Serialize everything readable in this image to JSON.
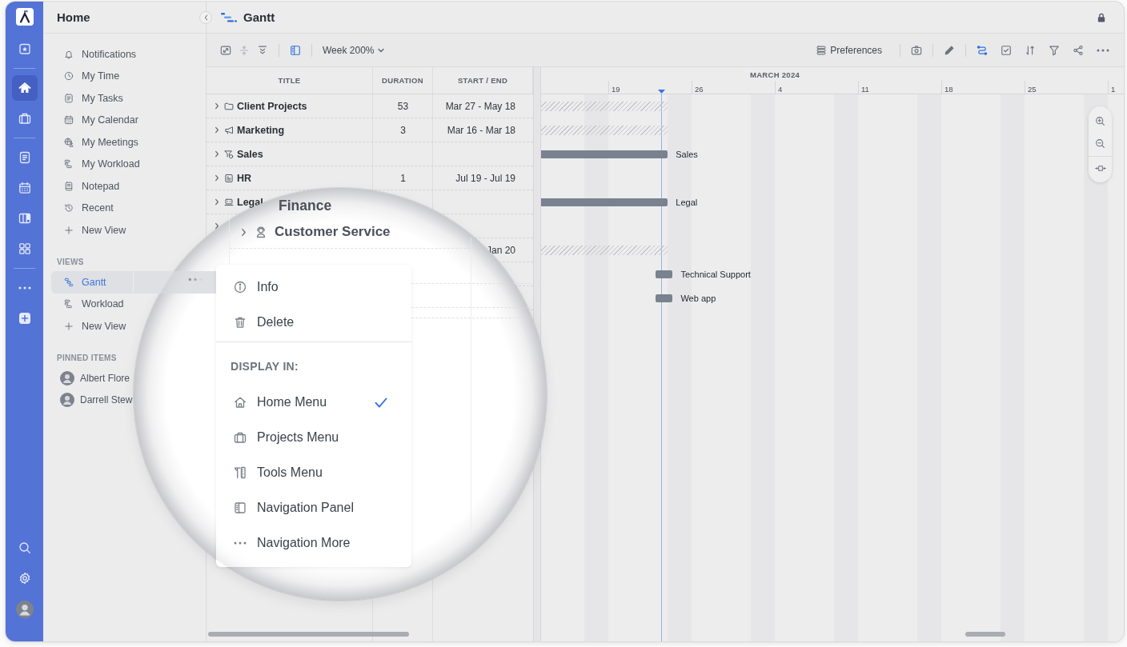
{
  "rail": {
    "groups": [
      [
        {
          "selected": false
        }
      ],
      [
        {
          "selected": true
        },
        {
          "selected": false
        }
      ],
      [
        {
          "selected": false
        },
        {
          "selected": false
        },
        {
          "selected": false
        },
        {
          "selected": false
        }
      ],
      [
        {
          "selected": false
        },
        {
          "selected": false
        }
      ]
    ],
    "bottom": [
      {
        "selected": false
      },
      {
        "selected": false
      }
    ]
  },
  "sidebar": {
    "title": "Home",
    "items": [
      {
        "label": "Notifications"
      },
      {
        "label": "My Time"
      },
      {
        "label": "My Tasks"
      },
      {
        "label": "My Calendar"
      },
      {
        "label": "My Meetings"
      },
      {
        "label": "My Workload"
      },
      {
        "label": "Notepad"
      },
      {
        "label": "Recent"
      },
      {
        "label": "New View"
      }
    ],
    "views_heading": "VIEWS",
    "views": [
      {
        "label": "Gantt",
        "selected": true
      },
      {
        "label": "Workload",
        "selected": false
      },
      {
        "label": "New View",
        "selected": false
      }
    ],
    "pinned_heading": "PINNED ITEMS",
    "pinned": [
      {
        "name": "Albert Flore"
      },
      {
        "name": "Darrell Stew"
      }
    ]
  },
  "header": {
    "title": "Gantt"
  },
  "toolbar": {
    "left_tools": [
      {
        "on": false,
        "disabled": false
      },
      {
        "on": false,
        "disabled": true
      },
      {
        "on": false,
        "disabled": false
      },
      {
        "on": true,
        "disabled": false
      }
    ],
    "scale": "Week 200%",
    "preferences": "Preferences",
    "right_tools": [
      {
        "on": false
      },
      {
        "on": false
      },
      {
        "on": true
      },
      {
        "on": false
      },
      {
        "on": false
      },
      {
        "on": false
      },
      {
        "on": false
      },
      {
        "on": false
      }
    ]
  },
  "table": {
    "columns": [
      "TITLE",
      "DURATION",
      "START / END"
    ],
    "rows": [
      {
        "title": "Client Projects",
        "expanded": false,
        "duration": "53",
        "dates": "Mar 27 - May 18",
        "bar": {
          "kind": "hatched"
        }
      },
      {
        "title": "Marketing",
        "expanded": false,
        "duration": "3",
        "dates": "Mar 16 - Mar 18",
        "bar": {
          "kind": "hatched"
        }
      },
      {
        "title": "Sales",
        "expanded": false,
        "bar": {
          "kind": "solid",
          "label": "Sales"
        }
      },
      {
        "title": "HR",
        "expanded": false,
        "duration": "1",
        "dates": "Jul 19 - Jul 19"
      },
      {
        "title": "Legal",
        "expanded": false,
        "bar": {
          "kind": "solid",
          "label": "Legal"
        }
      },
      {
        "expanded": false
      },
      {
        "dates": "Jan 20",
        "bar": {
          "kind": "hatched"
        }
      },
      {
        "bar": {
          "kind": "block",
          "label": "Technical Support"
        }
      },
      {
        "bar": {
          "kind": "block",
          "label": "Web app"
        }
      }
    ]
  },
  "timeline": {
    "month": "MARCH 2024",
    "weeks": [
      {
        "label": "19",
        "today": true
      },
      {
        "label": "26",
        "today": false
      },
      {
        "label": "4",
        "today": false
      },
      {
        "label": "11",
        "today": false
      },
      {
        "label": "18",
        "today": false
      },
      {
        "label": "25",
        "today": false
      },
      {
        "label": "1",
        "today": false
      }
    ]
  },
  "magnifier": {
    "heading": "Finance",
    "row": {
      "title": "Customer Service",
      "expanded": false
    },
    "menu": {
      "actions": [
        {
          "label": "Info"
        },
        {
          "label": "Delete"
        }
      ],
      "section": "DISPLAY IN:",
      "options": [
        {
          "label": "Home Menu",
          "checked": true
        },
        {
          "label": "Projects Menu",
          "checked": false
        },
        {
          "label": "Tools Menu",
          "checked": false
        },
        {
          "label": "Navigation Panel",
          "checked": false
        },
        {
          "label": "Navigation More",
          "checked": false
        }
      ]
    }
  }
}
